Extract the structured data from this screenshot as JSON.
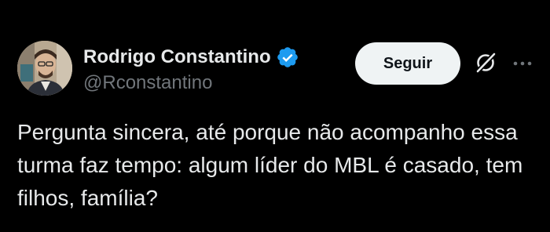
{
  "author": {
    "display_name": "Rodrigo Constantino",
    "handle": "@Rconstantino",
    "verified": true
  },
  "actions": {
    "follow_label": "Seguir"
  },
  "icons": {
    "verified": "verified-badge-icon",
    "grok": "grok-icon",
    "more": "more-options-icon"
  },
  "tweet": {
    "text": "Pergunta sincera, até porque não acompanho essa turma faz tempo: algum líder do MBL é casado, tem filhos, família?"
  },
  "colors": {
    "background": "#000000",
    "text_primary": "#e7e9ea",
    "text_secondary": "#71767b",
    "verified_blue": "#1d9bf0",
    "button_bg": "#eff3f4",
    "button_text": "#0f1419"
  }
}
